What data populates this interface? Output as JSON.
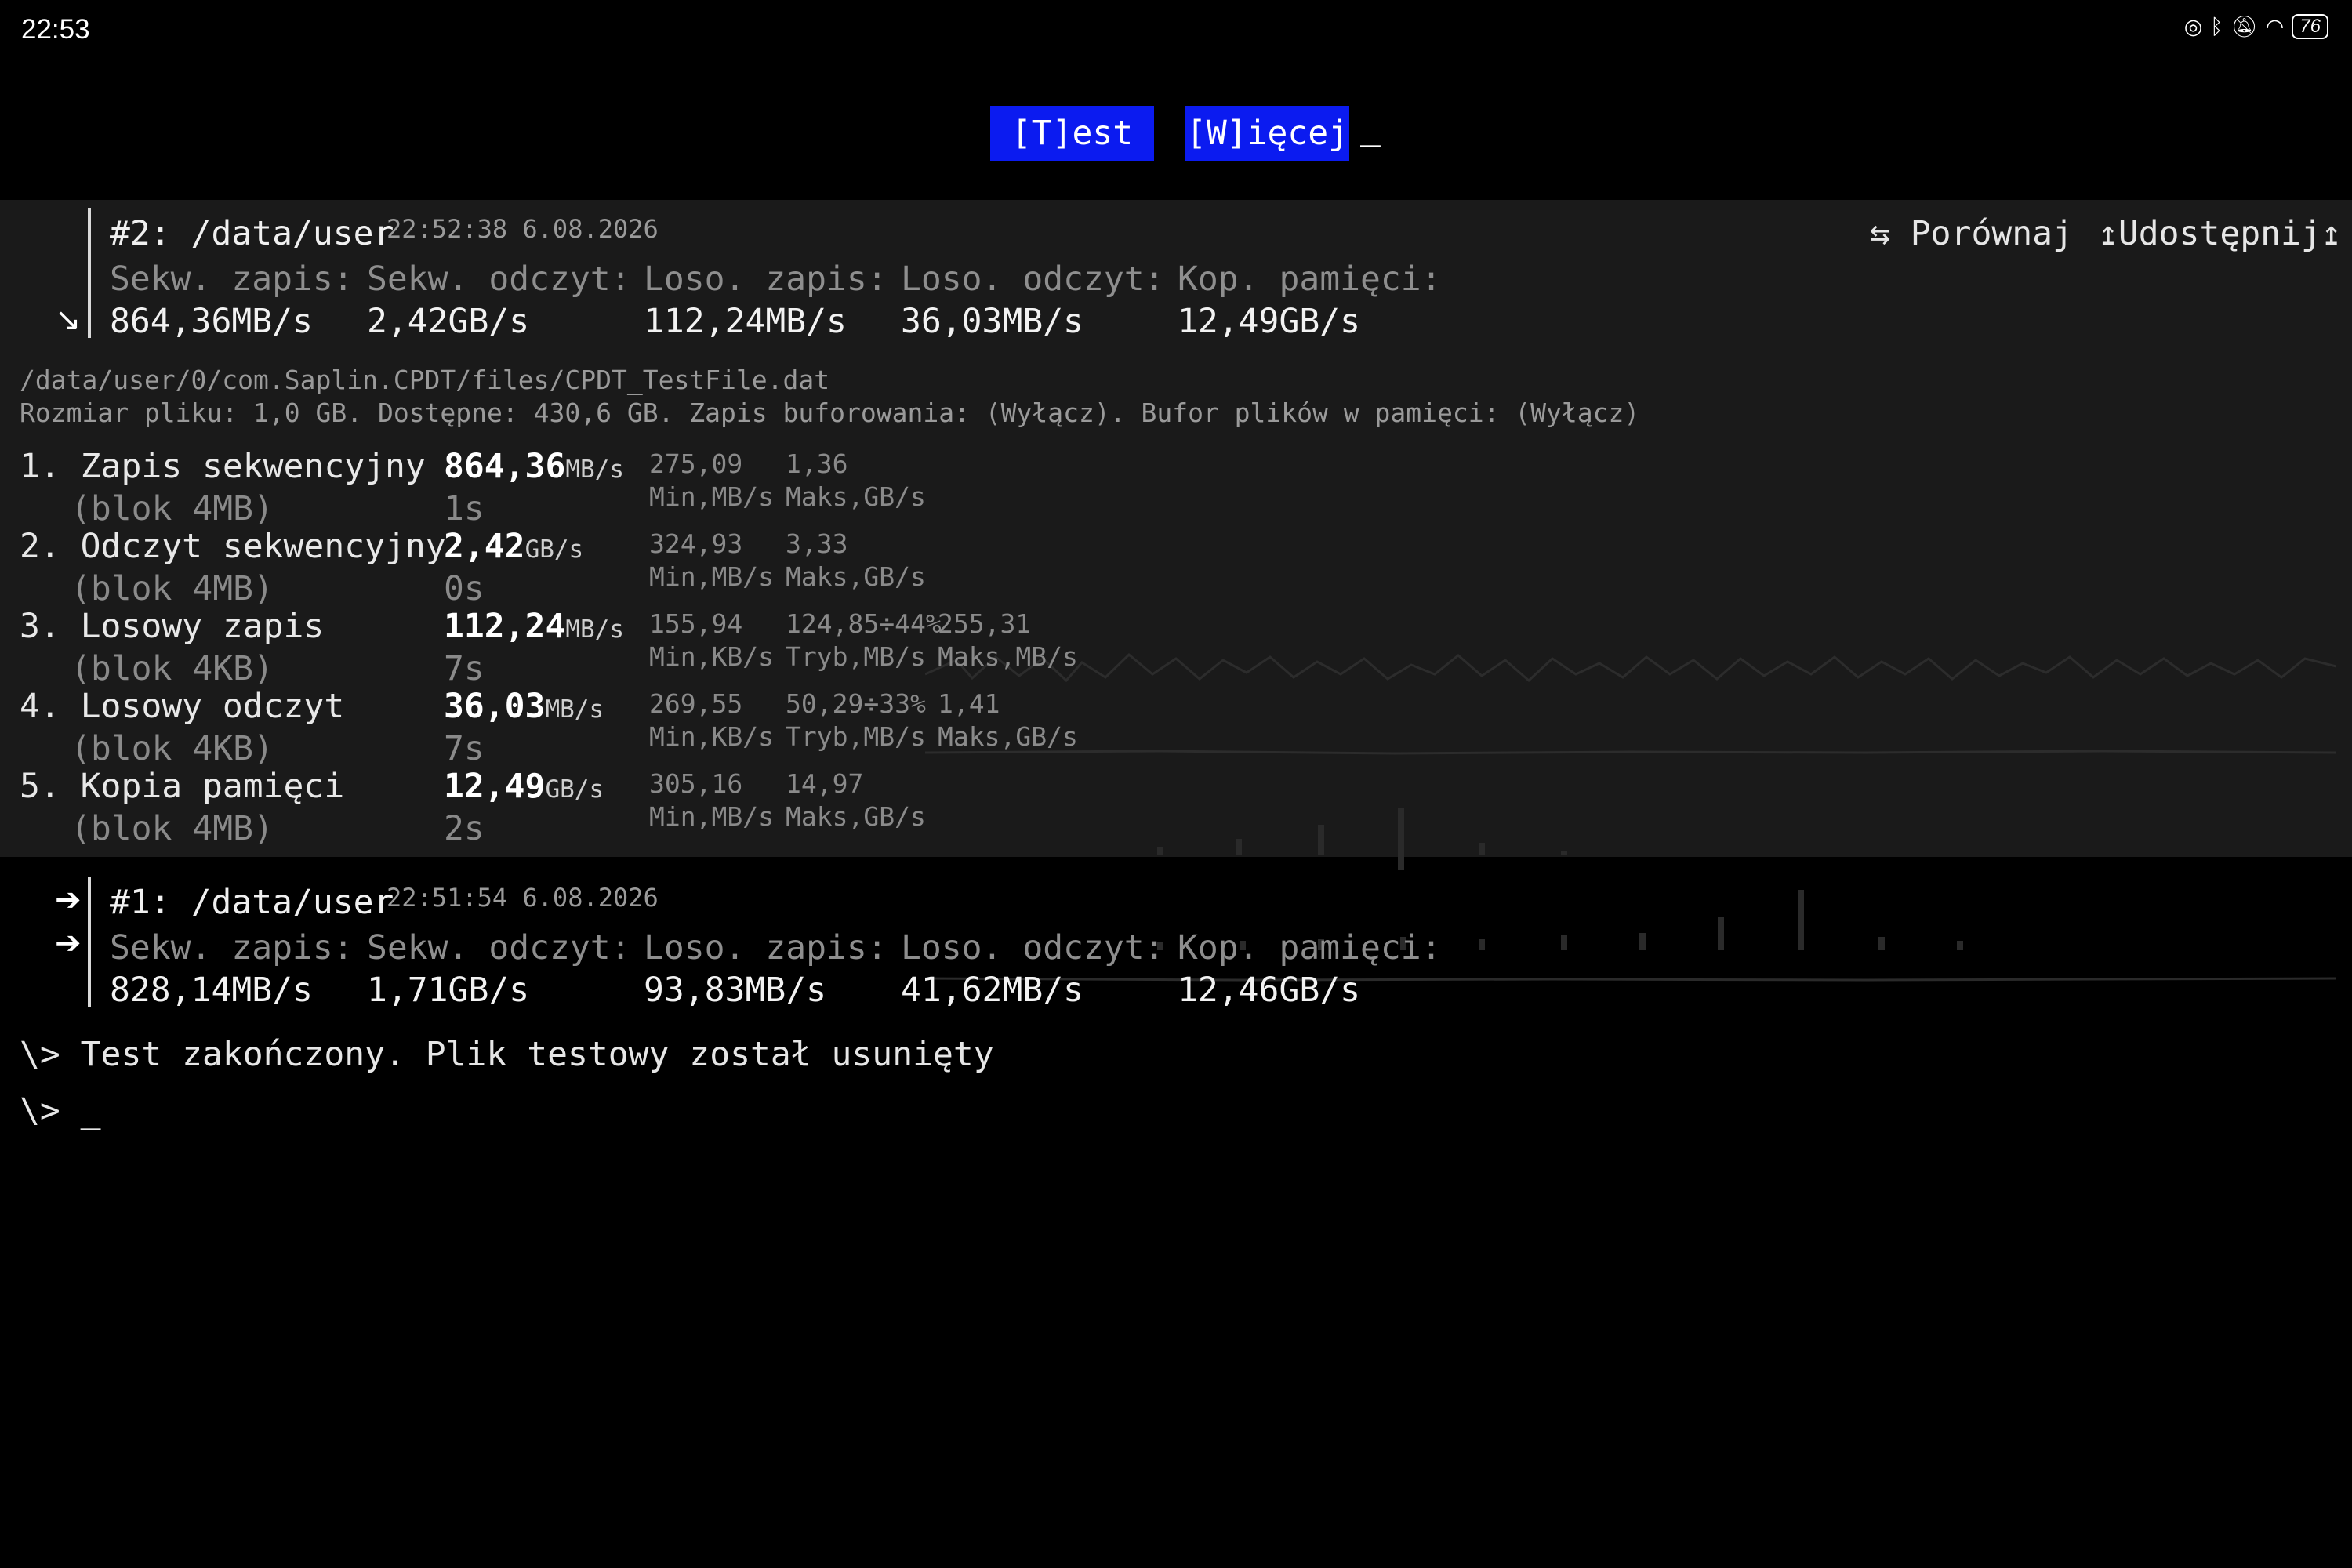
{
  "status_bar": {
    "time": "22:53",
    "icons": [
      "nfc-icon",
      "bluetooth-icon",
      "bell-off-icon",
      "wifi-icon",
      "battery-icon"
    ],
    "battery": "76"
  },
  "menu": {
    "test_label": "[T]est",
    "more_label": "[W]ięcej",
    "cursor": "_"
  },
  "run2": {
    "title": "#2: /data/user",
    "date": "22:52:38 6.08.2026",
    "compare_label": "⇆ Porównaj",
    "share_label": "↥Udostępnij↥",
    "headers": [
      "Sekw. zapis:",
      "Sekw. odczyt:",
      "Loso. zapis:",
      "Loso. odczyt:",
      "Kop. pamięci:"
    ],
    "values": [
      "864,36MB/s",
      "2,42GB/s",
      "112,24MB/s",
      "36,03MB/s",
      "12,49GB/s"
    ],
    "arrow": "↘"
  },
  "details": {
    "path": "/data/user/0/com.Saplin.CPDT/files/CPDT_TestFile.dat",
    "settings": "Rozmiar pliku: 1,0 GB. Dostępne: 430,6 GB. Zapis buforowania: (Wyłącz). Bufor plików w pamięci: (Wyłącz)"
  },
  "tests": [
    {
      "name": "1. Zapis sekwencyjny",
      "block": "(blok 4MB)",
      "value": "864,36",
      "unit": "MB/s",
      "time": "1s",
      "stats": [
        {
          "v": "275,09",
          "l": "Min,MB/s"
        },
        {
          "v": "1,36",
          "l": "Maks,GB/s"
        }
      ]
    },
    {
      "name": "2. Odczyt sekwencyjny",
      "block": "(blok 4MB)",
      "value": "2,42",
      "unit": "GB/s",
      "time": "0s",
      "stats": [
        {
          "v": "324,93",
          "l": "Min,MB/s"
        },
        {
          "v": "3,33",
          "l": "Maks,GB/s"
        }
      ]
    },
    {
      "name": "3. Losowy zapis",
      "block": "(blok 4KB)",
      "value": "112,24",
      "unit": "MB/s",
      "time": "7s",
      "stats": [
        {
          "v": "155,94",
          "l": "Min,KB/s"
        },
        {
          "v": "124,85÷44%",
          "l": "Tryb,MB/s"
        },
        {
          "v": "255,31",
          "l": "Maks,MB/s"
        }
      ]
    },
    {
      "name": "4. Losowy odczyt",
      "block": "(blok 4KB)",
      "value": "36,03",
      "unit": "MB/s",
      "time": "7s",
      "stats": [
        {
          "v": "269,55",
          "l": "Min,KB/s"
        },
        {
          "v": "50,29÷33%",
          "l": "Tryb,MB/s"
        },
        {
          "v": "1,41",
          "l": "Maks,GB/s"
        }
      ]
    },
    {
      "name": "5. Kopia pamięci",
      "block": "(blok 4MB)",
      "value": "12,49",
      "unit": "GB/s",
      "time": "2s",
      "stats": [
        {
          "v": "305,16",
          "l": "Min,MB/s"
        },
        {
          "v": "14,97",
          "l": "Maks,GB/s"
        }
      ]
    }
  ],
  "run1": {
    "title": "#1: /data/user",
    "date": "22:51:54 6.08.2026",
    "headers": [
      "Sekw. zapis:",
      "Sekw. odczyt:",
      "Loso. zapis:",
      "Loso. odczyt:",
      "Kop. pamięci:"
    ],
    "values": [
      "828,14MB/s",
      "1,71GB/s",
      "93,83MB/s",
      "41,62MB/s",
      "12,46GB/s"
    ],
    "arrows": [
      "➔",
      "➔"
    ]
  },
  "console": {
    "message": "\\> Test zakończony. Plik testowy został usunięty",
    "prompt": "\\> _"
  }
}
